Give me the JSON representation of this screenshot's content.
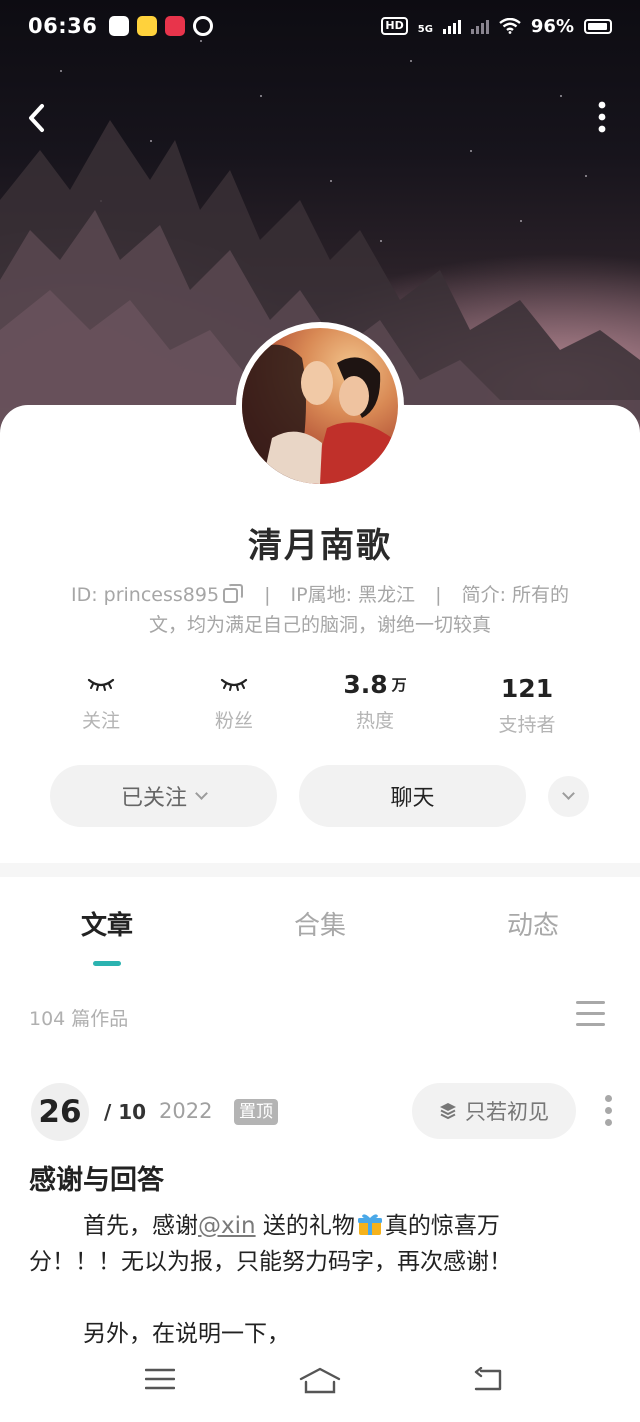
{
  "status_bar": {
    "time": "06:36",
    "hd_label": "HD",
    "network": "5G",
    "battery": "96%"
  },
  "profile": {
    "name": "清月南歌",
    "id_text": "ID: princess895",
    "ip_text": "IP属地:   黑龙江",
    "bio_line1": "简介: 所有的",
    "bio_line2": "文，均为满足自己的脑洞，谢绝一切较真",
    "separator": "|"
  },
  "stats": [
    {
      "label": "关注",
      "value": "",
      "unit": "",
      "hidden": true
    },
    {
      "label": "粉丝",
      "value": "",
      "unit": "",
      "hidden": true
    },
    {
      "label": "热度",
      "value": "3.8",
      "unit": "万"
    },
    {
      "label": "支持者",
      "value": "121",
      "unit": ""
    }
  ],
  "actions": {
    "follow_label": "已关注",
    "chat_label": "聊天"
  },
  "tabs": [
    {
      "label": "文章",
      "active": true
    },
    {
      "label": "合集",
      "active": false
    },
    {
      "label": "动态",
      "active": false
    }
  ],
  "works": {
    "count_text": "104 篇作品"
  },
  "article": {
    "day": "26",
    "month": "/ 10",
    "year": "2022",
    "pin_label": "置顶",
    "collection": "只若初见",
    "title": "感谢与回答",
    "body_prefix": "首先，感谢",
    "mention": "@xin",
    "body_mid": " 送的礼物",
    "body_suffix": "真的惊喜万分！！！无以为报，只能努力码字，再次感谢！",
    "body_next": "另外，在说明一下，"
  },
  "colors": {
    "accent": "#2bb3b0",
    "button_bg": "#f2f2f2",
    "muted_text": "#a6a6a6"
  },
  "icons": {
    "back": "chevron-left-icon",
    "more": "more-vertical-icon",
    "copy": "copy-icon",
    "expand": "chevron-down-icon",
    "list": "menu-icon",
    "collection": "layers-icon",
    "gift": "gift-icon",
    "nav_menu": "menu-icon",
    "nav_home": "home-icon",
    "nav_back": "return-icon"
  }
}
